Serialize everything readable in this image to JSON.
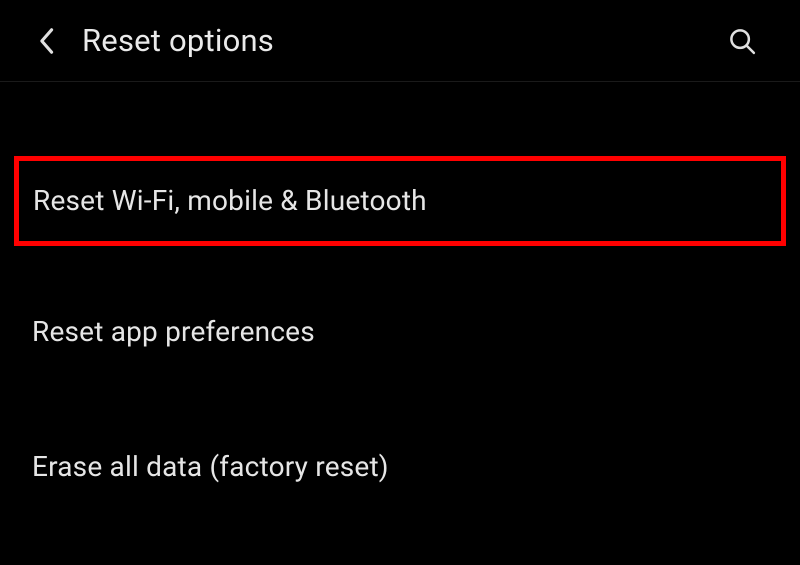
{
  "header": {
    "title": "Reset options"
  },
  "options": [
    {
      "label": "Reset Wi-Fi, mobile & Bluetooth",
      "highlighted": true
    },
    {
      "label": "Reset app preferences",
      "highlighted": false
    },
    {
      "label": "Erase all data (factory reset)",
      "highlighted": false
    }
  ]
}
